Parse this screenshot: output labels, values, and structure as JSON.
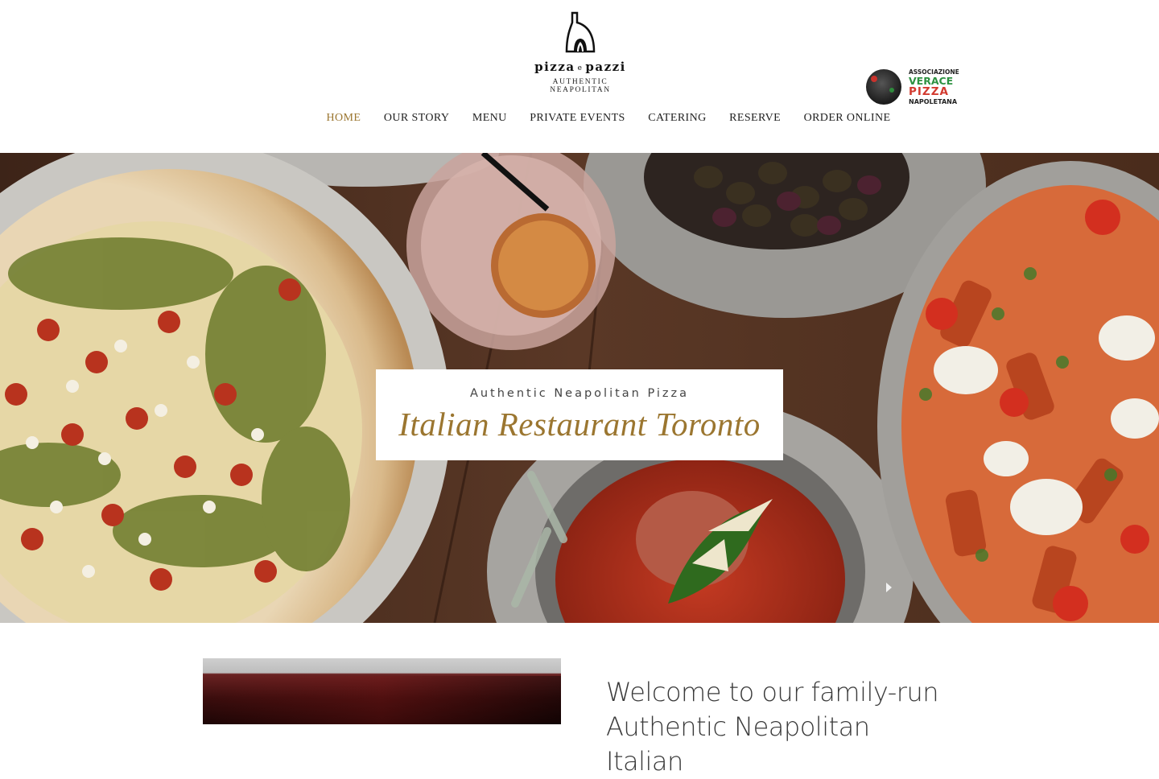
{
  "header": {
    "logo": {
      "brand_left": "pizza",
      "brand_joiner": "e",
      "brand_right": "pazzi",
      "tagline": "AUTHENTIC NEAPOLITAN",
      "icon": "pizza-oven-icon"
    },
    "certification_badge": {
      "line1": "ASSOCIAZIONE",
      "line2": "VERACE",
      "line3": "PIZZA",
      "line4": "NAPOLETANA",
      "colors": {
        "green": "#2d9141",
        "red": "#d23a2f"
      }
    },
    "nav": [
      {
        "label": "HOME",
        "active": true
      },
      {
        "label": "OUR STORY",
        "active": false
      },
      {
        "label": "MENU",
        "active": false
      },
      {
        "label": "PRIVATE EVENTS",
        "active": false
      },
      {
        "label": "CATERING",
        "active": false
      },
      {
        "label": "RESERVE",
        "active": false
      },
      {
        "label": "ORDER ONLINE",
        "active": false
      }
    ]
  },
  "hero": {
    "kicker": "Authentic Neapolitan Pizza",
    "title": "Italian Restaurant Toronto",
    "next_arrow_icon": "chevron-right-icon"
  },
  "intro": {
    "heading": "Welcome to our family-run Authentic Neapolitan Italian"
  },
  "colors": {
    "accent_gold": "#9b7630",
    "nav_text": "#1e1e1e",
    "background": "#ffffff"
  }
}
